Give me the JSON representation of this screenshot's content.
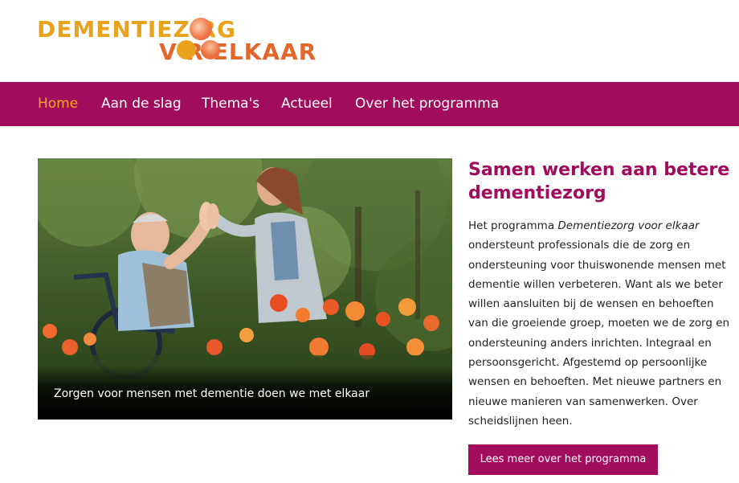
{
  "logo": {
    "line1": "DEMENTIEZ  RG",
    "line2": "V  R ELKAAR",
    "colors": {
      "orange_yellow": "#e8a21c",
      "orange_red": "#e3662a"
    }
  },
  "nav": {
    "items": [
      {
        "label": "Home",
        "active": true
      },
      {
        "label": "Aan de slag",
        "active": false
      },
      {
        "label": "Thema's",
        "active": false
      },
      {
        "label": "Actueel",
        "active": false
      },
      {
        "label": "Over het programma",
        "active": false
      }
    ],
    "background": "#a20c5c",
    "active_color": "#f5a623"
  },
  "hero": {
    "caption": "Zorgen voor mensen met dementie doen we met elkaar"
  },
  "intro": {
    "title": "Samen werken aan betere dementiezorg",
    "text_prefix": "Het programma ",
    "text_italic": "Dementiezorg voor elkaar",
    "text_body": " ondersteunt professionals die de zorg en ondersteuning voor thuiswonende mensen met dementie willen verbeteren. Want als we beter willen aansluiten bij de wensen en behoeften van die groeiende groep, moeten we de zorg en ondersteuning anders inrichten. Integraal en persoonsgericht. Afgestemd op persoonlijke wensen en behoeften. Met nieuwe partners en nieuwe manieren van samenwerken. Over scheidslijnen heen.",
    "button_label": "Lees meer over het programma"
  }
}
